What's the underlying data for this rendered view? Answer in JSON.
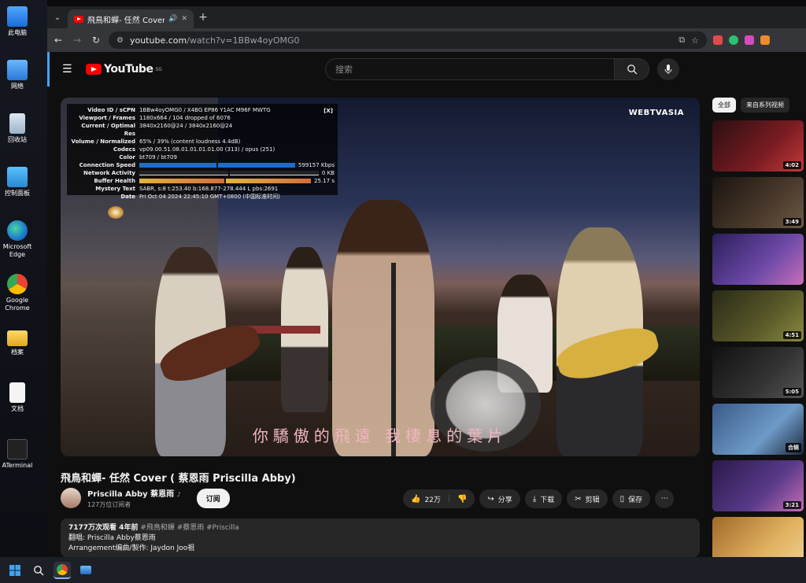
{
  "desktop": {
    "icons": [
      "此电脑",
      "网络",
      "回收站",
      "控制面板",
      "Microsoft Edge",
      "Google Chrome",
      "档案",
      "文档",
      "ATerminal"
    ]
  },
  "browser": {
    "tab_title": "飛鳥和蟬- 任然 Cover ( 蔡恩雨",
    "url_host": "youtube.com",
    "url_path": "/watch?v=1BBw4oyOMG0"
  },
  "youtube": {
    "region": "SG",
    "logo_text": "YouTube",
    "search_placeholder": "搜索",
    "stats": {
      "rows": [
        {
          "k": "Video ID / sCPN",
          "v": "1BBw4oyOMG0  /  X4BG  EP86  Y1AC  M96F  MWTG"
        },
        {
          "k": "Viewport / Frames",
          "v": "1180x664 / 104 dropped of 6076"
        },
        {
          "k": "Current / Optimal Res",
          "v": "3840x2160@24 / 3840x2160@24"
        },
        {
          "k": "Volume / Normalized",
          "v": "65% / 39% (content loudness 4.4dB)"
        },
        {
          "k": "Codecs",
          "v": "vp09.00.51.08.01.01.01.01.00 (313) / opus (251)"
        },
        {
          "k": "Color",
          "v": "bt709 / bt709"
        }
      ],
      "connection_label": "Connection Speed",
      "connection_value": "599157 Kbps",
      "network_label": "Network Activity",
      "network_value": "0 KB",
      "buffer_label": "Buffer Health",
      "buffer_value": "25.17 s",
      "mystery_label": "Mystery Text",
      "mystery_value": "SABR, s:8 t:253.40 b:168.877-278.444 L pbs:2691",
      "date_label": "Date",
      "date_value": "Fri Oct 04 2024 22:45:10 GMT+0800 (中国标准时间)",
      "close": "[X]"
    },
    "watermark": "WEBTVASIA",
    "lyrics": "你驕傲的飛遠 我棲息的葉片",
    "video_title": "飛鳥和蟬- 任然 Cover ( 蔡恩雨 Priscilla Abby)",
    "channel_name": "Priscilla Abby 蔡恩雨",
    "channel_subs": "127万位订阅者",
    "subscribe": "订阅",
    "likes": "22万",
    "share": "分享",
    "download": "下载",
    "clip": "剪辑",
    "save": "保存",
    "desc_line1_stats": "7177万次观看  4年前",
    "desc_line1_tags": "#飛鳥和蟬 #蔡恩雨 #Priscilla",
    "desc_line2": "翻唱: Priscilla Abby蔡恩雨",
    "desc_line3": "Arrangement编曲/製作: Jaydon Joo祖",
    "chips": [
      "全部",
      "来自系列视频"
    ],
    "thumbs": [
      {
        "dur": "4:02",
        "bg": "linear-gradient(135deg,#2a0f12,#7a1c22 60%,#c33a3a)"
      },
      {
        "dur": "3:49",
        "bg": "linear-gradient(135deg,#1a1410,#4a3a2c 60%,#6d5a44)"
      },
      {
        "dur": "",
        "bg": "linear-gradient(135deg,#2a1f5a,#6e4aa8 60%,#c86fb8)"
      },
      {
        "dur": "4:51",
        "bg": "linear-gradient(135deg,#2a2a18,#5a5a2a 60%,#8a8a40)"
      },
      {
        "dur": "5:05",
        "bg": "linear-gradient(135deg,#111,#333 60%,#555)"
      },
      {
        "dur": "",
        "bg": "linear-gradient(135deg,#3a5a88,#6e9ac8 60%,#1c2a3c)"
      },
      {
        "dur": "3:21",
        "bg": "linear-gradient(135deg,#2a1a4a,#5a3a8a 60%,#c86fb8)"
      },
      {
        "dur": "",
        "bg": "linear-gradient(135deg,#a06a2a,#e0b060 60%,#f0d090)"
      }
    ],
    "thumb6_label": "合辑"
  }
}
